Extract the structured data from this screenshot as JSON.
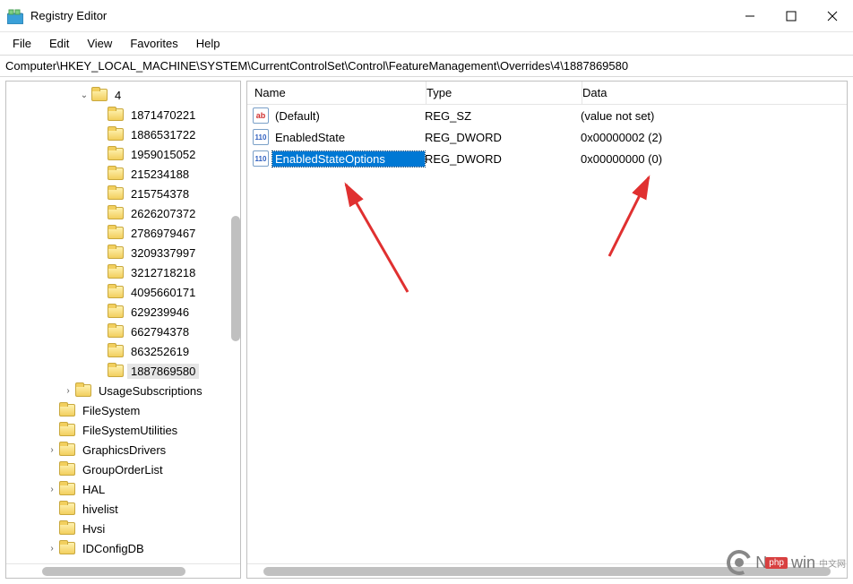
{
  "window": {
    "title": "Registry Editor"
  },
  "menu": {
    "items": [
      "File",
      "Edit",
      "View",
      "Favorites",
      "Help"
    ]
  },
  "address": "Computer\\HKEY_LOCAL_MACHINE\\SYSTEM\\CurrentControlSet\\Control\\FeatureManagement\\Overrides\\4\\1887869580",
  "tree": [
    {
      "indent": 4,
      "chev": "down",
      "label": "4",
      "selected": false
    },
    {
      "indent": 5,
      "chev": "",
      "label": "1871470221"
    },
    {
      "indent": 5,
      "chev": "",
      "label": "1886531722"
    },
    {
      "indent": 5,
      "chev": "",
      "label": "1959015052"
    },
    {
      "indent": 5,
      "chev": "",
      "label": "215234188"
    },
    {
      "indent": 5,
      "chev": "",
      "label": "215754378"
    },
    {
      "indent": 5,
      "chev": "",
      "label": "2626207372"
    },
    {
      "indent": 5,
      "chev": "",
      "label": "2786979467"
    },
    {
      "indent": 5,
      "chev": "",
      "label": "3209337997"
    },
    {
      "indent": 5,
      "chev": "",
      "label": "3212718218"
    },
    {
      "indent": 5,
      "chev": "",
      "label": "4095660171"
    },
    {
      "indent": 5,
      "chev": "",
      "label": "629239946"
    },
    {
      "indent": 5,
      "chev": "",
      "label": "662794378"
    },
    {
      "indent": 5,
      "chev": "",
      "label": "863252619"
    },
    {
      "indent": 5,
      "chev": "",
      "label": "1887869580",
      "selected": true
    },
    {
      "indent": 3,
      "chev": "right",
      "label": "UsageSubscriptions"
    },
    {
      "indent": 2,
      "chev": "",
      "label": "FileSystem"
    },
    {
      "indent": 2,
      "chev": "",
      "label": "FileSystemUtilities"
    },
    {
      "indent": 2,
      "chev": "right",
      "label": "GraphicsDrivers"
    },
    {
      "indent": 2,
      "chev": "",
      "label": "GroupOrderList"
    },
    {
      "indent": 2,
      "chev": "right",
      "label": "HAL"
    },
    {
      "indent": 2,
      "chev": "",
      "label": "hivelist"
    },
    {
      "indent": 2,
      "chev": "",
      "label": "Hvsi"
    },
    {
      "indent": 2,
      "chev": "right",
      "label": "IDConfigDB"
    }
  ],
  "details": {
    "columns": {
      "name": "Name",
      "type": "Type",
      "data": "Data"
    },
    "rows": [
      {
        "icon": "string",
        "icon_text": "ab",
        "name": "(Default)",
        "type": "REG_SZ",
        "data": "(value not set)",
        "selected": false
      },
      {
        "icon": "dword",
        "icon_text": "110",
        "name": "EnabledState",
        "type": "REG_DWORD",
        "data": "0x00000002 (2)",
        "selected": false
      },
      {
        "icon": "dword",
        "icon_text": "110",
        "name": "EnabledStateOptions",
        "type": "REG_DWORD",
        "data": "0x00000000 (0)",
        "selected": true
      }
    ]
  },
  "watermark": {
    "brand_left": "N",
    "brand_right": "win",
    "php": "php",
    "cn": "中文网"
  }
}
